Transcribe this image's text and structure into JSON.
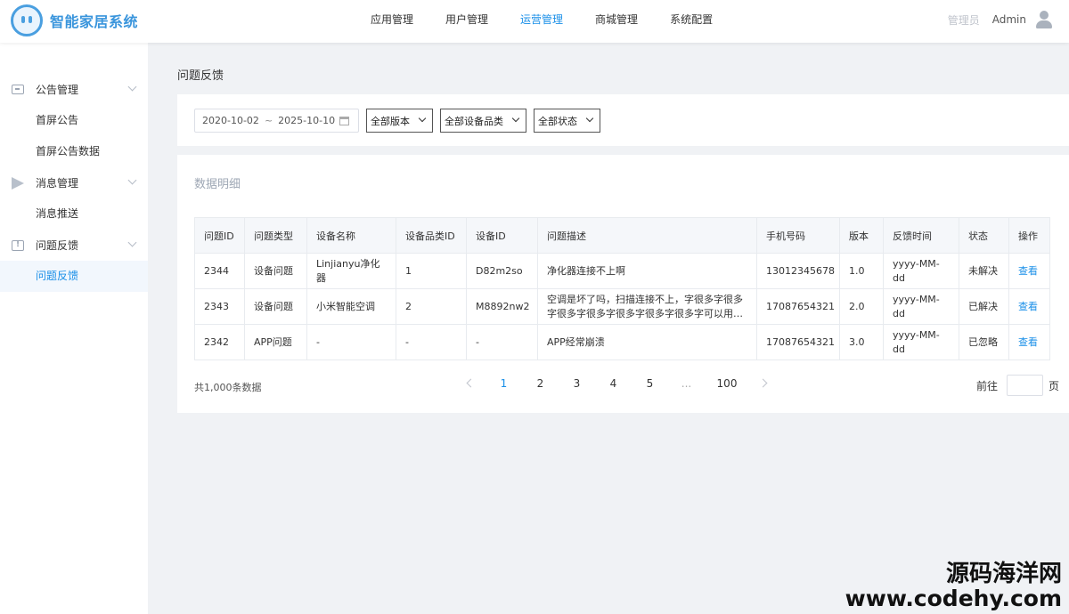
{
  "app": {
    "title": "智能家居系统"
  },
  "topnav": [
    {
      "label": "应用管理",
      "active": false
    },
    {
      "label": "用户管理",
      "active": false
    },
    {
      "label": "运营管理",
      "active": true
    },
    {
      "label": "商城管理",
      "active": false
    },
    {
      "label": "系统配置",
      "active": false
    }
  ],
  "header": {
    "role": "管理员",
    "username": "Admin"
  },
  "sidebar": {
    "groups": [
      {
        "label": "公告管理",
        "icon": "announcement-icon",
        "items": [
          "首屏公告",
          "首屏公告数据"
        ]
      },
      {
        "label": "消息管理",
        "icon": "paper-plane-icon",
        "items": [
          "消息推送"
        ]
      },
      {
        "label": "问题反馈",
        "icon": "feedback-icon",
        "items": [
          "问题反馈"
        ]
      }
    ],
    "active_item": "问题反馈"
  },
  "page": {
    "title": "问题反馈"
  },
  "filters": {
    "date_start": "2020-10-02",
    "date_sep": "~",
    "date_end": "2025-10-10",
    "version": "全部版本",
    "category": "全部设备品类",
    "status": "全部状态"
  },
  "table": {
    "title": "数据明细",
    "columns": [
      "问题ID",
      "问题类型",
      "设备名称",
      "设备品类ID",
      "设备ID",
      "问题描述",
      "手机号码",
      "版本",
      "反馈时间",
      "状态",
      "操作"
    ],
    "rows": [
      {
        "id": "2344",
        "type": "设备问题",
        "device": "Linjianyu净化器",
        "category_id": "1",
        "device_id": "D82m2so",
        "desc": "净化器连接不上啊",
        "phone": "13012345678",
        "version": "1.0",
        "time": "yyyy-MM-dd",
        "status": "未解决",
        "action": "查看"
      },
      {
        "id": "2343",
        "type": "设备问题",
        "device": "小米智能空调",
        "category_id": "2",
        "device_id": "M8892nw2",
        "desc": "空调是坏了吗，扫描连接不上，字很多字很多字很多字很多字很多字很多字很多字可以用…",
        "phone": "17087654321",
        "version": "2.0",
        "time": "yyyy-MM-dd",
        "status": "已解决",
        "action": "查看"
      },
      {
        "id": "2342",
        "type": "APP问题",
        "device": "-",
        "category_id": "-",
        "device_id": "-",
        "desc": "APP经常崩溃",
        "phone": "17087654321",
        "version": "3.0",
        "time": "yyyy-MM-dd",
        "status": "已忽略",
        "action": "查看"
      }
    ]
  },
  "pagination": {
    "total_text": "共1,000条数据",
    "pages": [
      "1",
      "2",
      "3",
      "4",
      "5",
      "...",
      "100"
    ],
    "current": "1",
    "goto_label": "前往",
    "page_suffix": "页"
  },
  "watermark": {
    "line1": "源码海洋网",
    "line2": "www.codehy.com"
  },
  "colors": {
    "accent": "#1a8fe8",
    "danger": "#e05b5b",
    "muted": "#999999",
    "logo": "#3a95dc"
  }
}
